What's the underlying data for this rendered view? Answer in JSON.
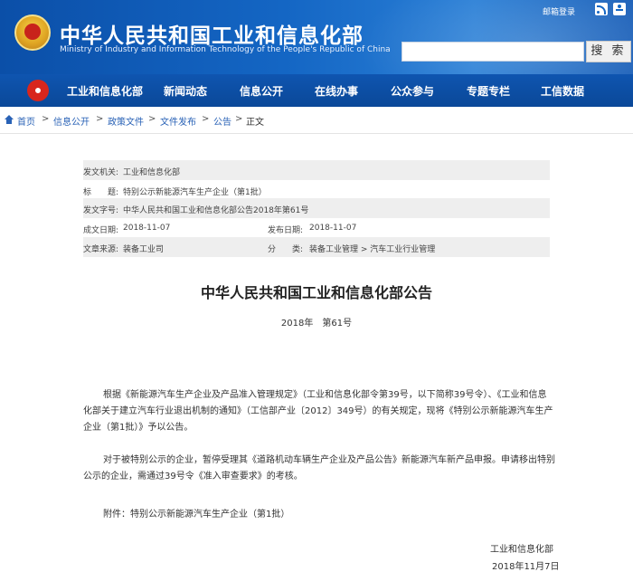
{
  "header": {
    "title": "中华人民共和国工业和信息化部",
    "subtitle": "Ministry of Industry and Information Technology of the People's Republic of China",
    "mail_login": "邮箱登录",
    "search_button": "搜 索",
    "search_placeholder": ""
  },
  "nav": {
    "items": [
      "工业和信息化部",
      "新闻动态",
      "信息公开",
      "在线办事",
      "公众参与",
      "专题专栏",
      "工信数据"
    ]
  },
  "breadcrumb": {
    "items": [
      "首页",
      "信息公开",
      "政策文件",
      "文件发布",
      "公告",
      "正文"
    ],
    "separator": ">"
  },
  "info": {
    "issuer_label": "发文机关:",
    "issuer_value": "工业和信息化部",
    "title_label": "标　　题:",
    "title_value": "特别公示新能源汽车生产企业（第1批）",
    "docno_label": "发文字号:",
    "docno_value": "中华人民共和国工业和信息化部公告2018年第61号",
    "created_label": "成文日期:",
    "created_value": "2018-11-07",
    "published_label": "发布日期:",
    "published_value": "2018-11-07",
    "source_label": "文章来源:",
    "source_value": "装备工业司",
    "category_label": "分　　类:",
    "category_value": "装备工业管理 > 汽车工业行业管理"
  },
  "article": {
    "title": "中华人民共和国工业和信息化部公告",
    "number": "2018年　第61号",
    "para1": [
      "根据《新能源汽车生产企业及产品准入管理规定》（工业和信息化部令第39号，以下简称39号令）、《工业和信息",
      "化部关于建立汽车行业退出机制的通知》（工信部产业〔2012〕349号）的有关规定，现将《特别公示新能源汽车生产",
      "企业（第1批）》予以公告。"
    ],
    "para2": [
      "对于被特别公示的企业，暂停受理其《道路机动车辆生产企业及产品公告》新能源汽车新产品申报。申请移出特别",
      "公示的企业，需通过39号令《准入审查要求》的考核。"
    ],
    "attachment": "附件：特别公示新能源汽车生产企业（第1批）",
    "signature": "工业和信息化部",
    "date": "2018年11月7日"
  }
}
